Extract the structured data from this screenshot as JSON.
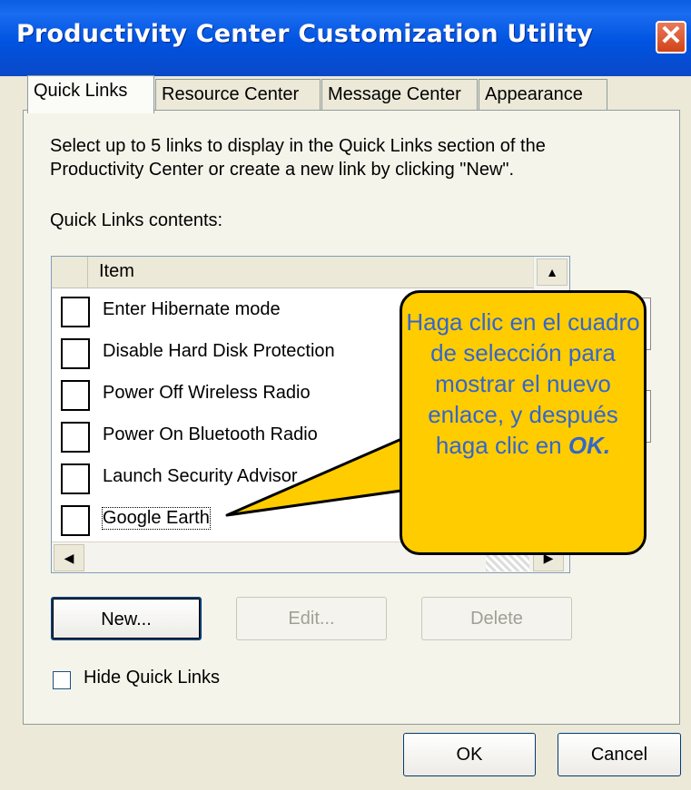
{
  "window": {
    "title": "Productivity Center Customization Utility",
    "close_symbol": "✕"
  },
  "tabs": [
    {
      "label": "Quick Links",
      "active": true
    },
    {
      "label": "Resource Center",
      "active": false
    },
    {
      "label": "Message Center",
      "active": false
    },
    {
      "label": "Appearance",
      "active": false
    }
  ],
  "description": "Select up to 5 links to display in the Quick Links section of the Productivity Center or create a new link by clicking \"New\".",
  "contents_label": "Quick Links contents:",
  "list": {
    "header": "Item",
    "rows": [
      {
        "label": "Enter Hibernate mode",
        "checked": false
      },
      {
        "label": "Disable Hard Disk Protection",
        "checked": false
      },
      {
        "label": "Power Off Wireless Radio",
        "checked": false
      },
      {
        "label": "Power On Bluetooth Radio",
        "checked": false
      },
      {
        "label": "Launch Security Advisor",
        "checked": false
      },
      {
        "label": "Google Earth",
        "checked": false
      }
    ]
  },
  "buttons": {
    "new": "New...",
    "edit": "Edit...",
    "delete": "Delete",
    "ok": "OK",
    "cancel": "Cancel"
  },
  "hide_checkbox": {
    "label": "Hide Quick Links",
    "checked": false
  },
  "callout": {
    "text": "Haga clic en el cuadro de selección para mostrar el nuevo enlace, y después haga clic en",
    "emphasis": "OK."
  },
  "colors": {
    "titlebar": "#0053e0",
    "callout_fill": "#ffcc00",
    "callout_text": "#3366cc"
  }
}
